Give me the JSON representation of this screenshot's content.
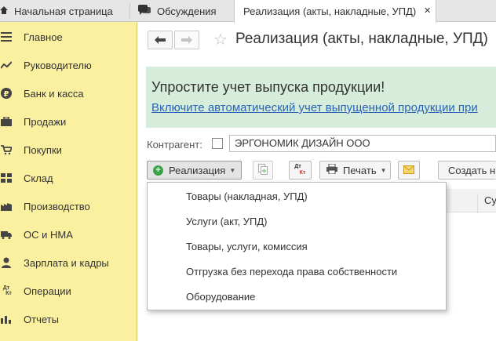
{
  "tabs": [
    {
      "label": "Начальная страница",
      "icon": "home-icon"
    },
    {
      "label": "Обсуждения",
      "icon": "chat-icon"
    },
    {
      "label": "Реализация (акты, накладные, УПД)",
      "icon": "close-icon",
      "active": true
    }
  ],
  "sidebar": {
    "items": [
      {
        "label": "Главное",
        "icon": "menu-icon"
      },
      {
        "label": "Руководителю",
        "icon": "trend-icon"
      },
      {
        "label": "Банк и касса",
        "icon": "ruble-icon"
      },
      {
        "label": "Продажи",
        "icon": "briefcase-icon"
      },
      {
        "label": "Покупки",
        "icon": "cart-icon"
      },
      {
        "label": "Склад",
        "icon": "warehouse-icon"
      },
      {
        "label": "Производство",
        "icon": "factory-icon"
      },
      {
        "label": "ОС и НМА",
        "icon": "truck-icon"
      },
      {
        "label": "Зарплата и кадры",
        "icon": "person-icon"
      },
      {
        "label": "Операции",
        "icon": "dt-kt-icon"
      },
      {
        "label": "Отчеты",
        "icon": "bar-chart-icon"
      }
    ],
    "bg_color": "#fbf0a0"
  },
  "header": {
    "title": "Реализация (акты, накладные, УПД)"
  },
  "banner": {
    "title": "Упростите учет выпуска продукции!",
    "link": "Включите автоматический учет выпущенной продукции при",
    "bg_color": "#d7eddb"
  },
  "filter": {
    "label": "Контрагент:",
    "value": "ЭРГОНОМИК ДИЗАЙН ООО"
  },
  "toolbar": {
    "realization_label": "Реализация",
    "dtkt_top": "Дт",
    "dtkt_bottom": "Кт",
    "print_label": "Печать",
    "create_label": "Создать н"
  },
  "table": {
    "header_partial": "Су"
  },
  "dropdown": {
    "items": [
      "Товары (накладная, УПД)",
      "Услуги (акт, УПД)",
      "Товары, услуги, комиссия",
      "Отгрузка без перехода права собственности",
      "Оборудование"
    ]
  }
}
